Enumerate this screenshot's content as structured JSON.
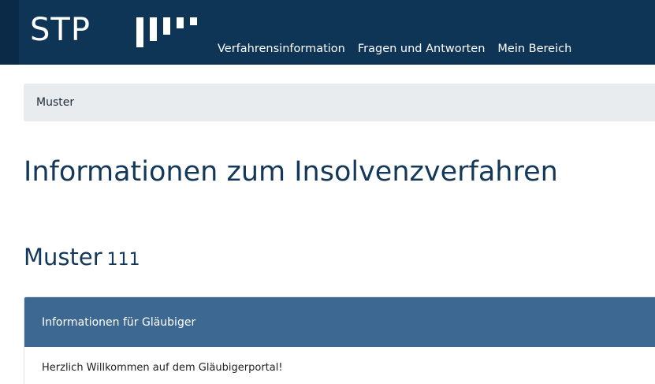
{
  "header": {
    "logo_text": "STP",
    "nav": [
      {
        "label": "Verfahrensinformation"
      },
      {
        "label": "Fragen und Antworten"
      },
      {
        "label": "Mein Bereich"
      }
    ]
  },
  "breadcrumb": {
    "items": [
      "Muster"
    ]
  },
  "main": {
    "title": "Informationen zum Insolvenzverfahren",
    "case_name": "Muster",
    "case_number": "111",
    "card": {
      "header": "Informationen für Gläubiger",
      "body": "Herzlich Willkommen auf dem Gläubigerportal!"
    }
  },
  "colors": {
    "header_bg": "#0e3456",
    "card_header_bg": "#3d6891",
    "title_text": "#14385a",
    "breadcrumb_bg": "#e9ecef"
  }
}
